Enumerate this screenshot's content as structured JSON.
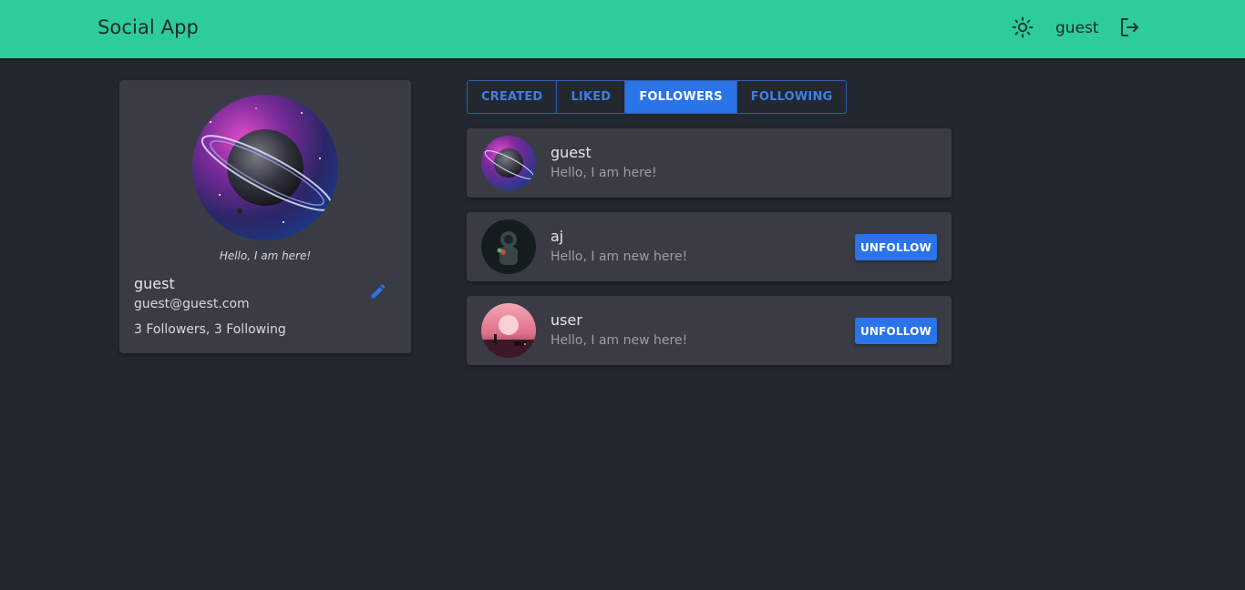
{
  "header": {
    "app_title": "Social App",
    "username": "guest",
    "theme_icon": "sun-icon",
    "logout_icon": "logout-icon"
  },
  "profile": {
    "bio": "Hello, I am here!",
    "name": "guest",
    "email": "guest@guest.com",
    "stats": "3 Followers, 3 Following",
    "edit_icon": "pencil-icon"
  },
  "tabs": [
    {
      "label": "CREATED",
      "active": false
    },
    {
      "label": "LIKED",
      "active": false
    },
    {
      "label": "FOLLOWERS",
      "active": true
    },
    {
      "label": "FOLLOWING",
      "active": false
    }
  ],
  "users": [
    {
      "name": "guest",
      "bio": "Hello, I am here!",
      "button": ""
    },
    {
      "name": "aj",
      "bio": "Hello, I am new here!",
      "button": "UNFOLLOW"
    },
    {
      "name": "user",
      "bio": "Hello, I am new here!",
      "button": "UNFOLLOW"
    }
  ],
  "colors": {
    "topbar": "#2ecc9a",
    "background": "#23272f",
    "card": "#393c45",
    "accent": "#2a74e8"
  }
}
